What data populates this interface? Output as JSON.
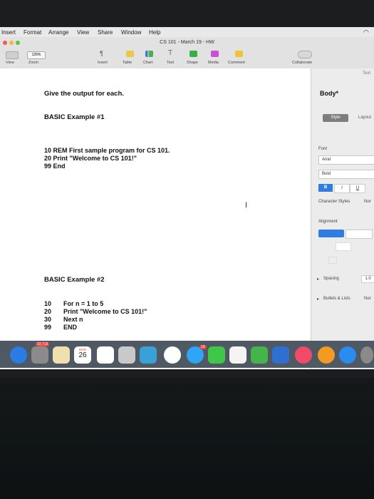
{
  "menubar": {
    "items": [
      "Insert",
      "Format",
      "Arrange",
      "View",
      "Share",
      "Window",
      "Help"
    ]
  },
  "toolbar": {
    "doc_title": "CS 101 - March 19 - HW",
    "zoom": "125%",
    "buttons": [
      "View",
      "Zoom",
      "Insert",
      "Table",
      "Chart",
      "Text",
      "Shape",
      "Media",
      "Comment",
      "Collaborate"
    ],
    "pilcrow": "¶"
  },
  "document": {
    "heading": "Give the output for each.",
    "example1_title": "BASIC Example #1",
    "example1_lines": [
      "10  REM  First sample program for CS 101.",
      "20  Print \"Welcome to CS 101!\"",
      "99  End"
    ],
    "example2_title": "BASIC Example #2",
    "example2_lines": [
      {
        "num": "10",
        "code": "For n = 1 to 5"
      },
      {
        "num": "20",
        "code": "Print \"Welcome to CS 101!\""
      },
      {
        "num": "30",
        "code": "Next n"
      },
      {
        "num": "99",
        "code": "END"
      }
    ]
  },
  "sidebar": {
    "text_tab": "Text",
    "para_style": "Body*",
    "tabs": [
      "Style",
      "Layout"
    ],
    "font_label": "Font",
    "font_name": "Arial",
    "font_weight": "Bold",
    "bold": "B",
    "italic": "I",
    "underline": "U",
    "char_styles_label": "Character Styles",
    "char_styles_value": "Nor",
    "alignment_label": "Alignment",
    "spacing_label": "Spacing",
    "spacing_value": "1.0",
    "bullets_label": "Bullets & Lists",
    "bullets_value": "Nor"
  },
  "dock": {
    "calendar_day": "26",
    "calendar_month": "MAR",
    "badge_count": "19",
    "mail_badge": "22,713"
  },
  "colors": {
    "accent": "#2f7de1",
    "toolbar": "#e2e2e2",
    "dock": "#4f5964"
  }
}
